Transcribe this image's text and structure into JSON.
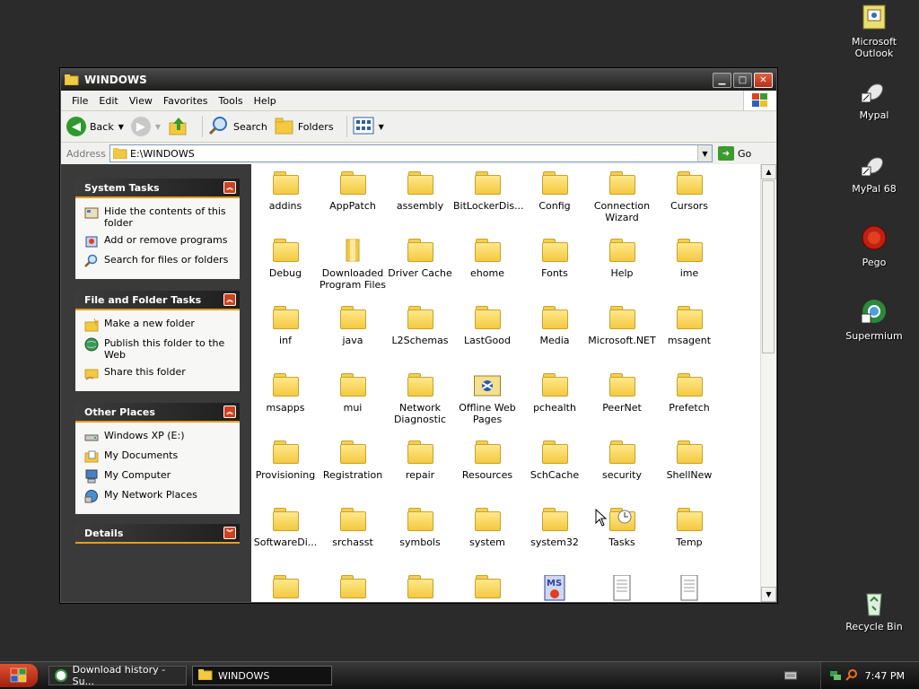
{
  "desktop": {
    "icons": [
      {
        "label_line1": "Microsoft",
        "label_line2": "Outlook",
        "icon": "outlook-icon"
      },
      {
        "label_line1": "Mypal",
        "label_line2": "",
        "icon": "mypal-icon"
      },
      {
        "label_line1": "MyPal 68",
        "label_line2": "",
        "icon": "mypal68-icon"
      },
      {
        "label_line1": "Pego",
        "label_line2": "",
        "icon": "pego-icon"
      },
      {
        "label_line1": "Supermium",
        "label_line2": "",
        "icon": "supermium-icon"
      },
      {
        "label_line1": "Recycle Bin",
        "label_line2": "",
        "icon": "recycle-bin-icon"
      }
    ]
  },
  "window": {
    "title": "WINDOWS",
    "menu": [
      "File",
      "Edit",
      "View",
      "Favorites",
      "Tools",
      "Help"
    ],
    "toolbar": {
      "back": "Back",
      "search": "Search",
      "folders": "Folders"
    },
    "address": {
      "label": "Address",
      "value": "E:\\WINDOWS",
      "go": "Go"
    }
  },
  "sidebar": {
    "system_tasks": {
      "title": "System Tasks",
      "items": [
        {
          "label": "Hide the contents of this folder",
          "icon": "hide-contents-icon"
        },
        {
          "label": "Add or remove programs",
          "icon": "add-remove-programs-icon"
        },
        {
          "label": "Search for files or folders",
          "icon": "search-icon"
        }
      ]
    },
    "file_folder_tasks": {
      "title": "File and Folder Tasks",
      "items": [
        {
          "label": "Make a new folder",
          "icon": "new-folder-icon"
        },
        {
          "label": "Publish this folder to the Web",
          "icon": "globe-icon"
        },
        {
          "label": "Share this folder",
          "icon": "share-folder-icon"
        }
      ]
    },
    "other_places": {
      "title": "Other Places",
      "items": [
        {
          "label": "Windows XP (E:)",
          "icon": "drive-icon"
        },
        {
          "label": "My Documents",
          "icon": "my-documents-icon"
        },
        {
          "label": "My Computer",
          "icon": "my-computer-icon"
        },
        {
          "label": "My Network Places",
          "icon": "network-icon"
        }
      ]
    },
    "details": {
      "title": "Details"
    }
  },
  "folders": [
    {
      "l1": "addins",
      "l2": ""
    },
    {
      "l1": "AppPatch",
      "l2": ""
    },
    {
      "l1": "assembly",
      "l2": ""
    },
    {
      "l1": "BitLockerDis...",
      "l2": ""
    },
    {
      "l1": "Config",
      "l2": ""
    },
    {
      "l1": "Connection",
      "l2": "Wizard"
    },
    {
      "l1": "Cursors",
      "l2": ""
    },
    {
      "l1": "Debug",
      "l2": ""
    },
    {
      "l1": "Downloaded",
      "l2": "Program Files"
    },
    {
      "l1": "Driver Cache",
      "l2": ""
    },
    {
      "l1": "ehome",
      "l2": ""
    },
    {
      "l1": "Fonts",
      "l2": ""
    },
    {
      "l1": "Help",
      "l2": ""
    },
    {
      "l1": "ime",
      "l2": ""
    },
    {
      "l1": "inf",
      "l2": ""
    },
    {
      "l1": "java",
      "l2": ""
    },
    {
      "l1": "L2Schemas",
      "l2": ""
    },
    {
      "l1": "LastGood",
      "l2": ""
    },
    {
      "l1": "Media",
      "l2": ""
    },
    {
      "l1": "Microsoft.NET",
      "l2": ""
    },
    {
      "l1": "msagent",
      "l2": ""
    },
    {
      "l1": "msapps",
      "l2": ""
    },
    {
      "l1": "mui",
      "l2": ""
    },
    {
      "l1": "Network",
      "l2": "Diagnostic"
    },
    {
      "l1": "Offline Web",
      "l2": "Pages"
    },
    {
      "l1": "pchealth",
      "l2": ""
    },
    {
      "l1": "PeerNet",
      "l2": ""
    },
    {
      "l1": "Prefetch",
      "l2": ""
    },
    {
      "l1": "Provisioning",
      "l2": ""
    },
    {
      "l1": "Registration",
      "l2": ""
    },
    {
      "l1": "repair",
      "l2": ""
    },
    {
      "l1": "Resources",
      "l2": ""
    },
    {
      "l1": "SchCache",
      "l2": ""
    },
    {
      "l1": "security",
      "l2": ""
    },
    {
      "l1": "ShellNew",
      "l2": ""
    },
    {
      "l1": "SoftwareDi...",
      "l2": ""
    },
    {
      "l1": "srchasst",
      "l2": ""
    },
    {
      "l1": "symbols",
      "l2": ""
    },
    {
      "l1": "system",
      "l2": ""
    },
    {
      "l1": "system32",
      "l2": ""
    },
    {
      "l1": "Tasks",
      "l2": ""
    },
    {
      "l1": "Temp",
      "l2": ""
    }
  ],
  "partial_row": [
    "folder",
    "folder",
    "folder",
    "folder",
    "ms-file",
    "document",
    "document"
  ],
  "taskbar": {
    "buttons": [
      {
        "label": "Download history - Su..."
      },
      {
        "label": "WINDOWS"
      }
    ],
    "clock": "7:47 PM"
  }
}
